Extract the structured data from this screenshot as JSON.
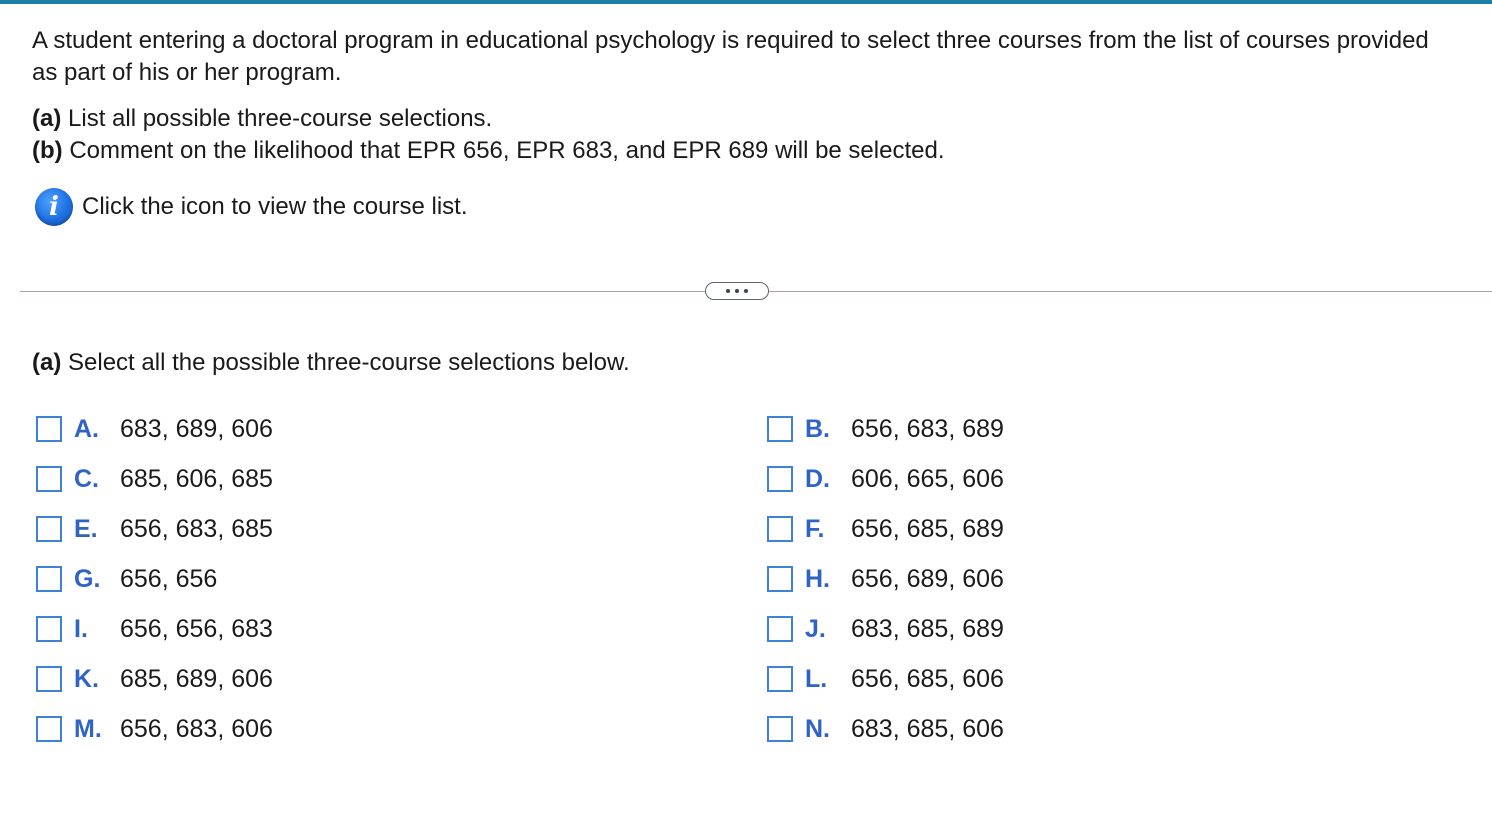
{
  "question": {
    "text": "A student entering a doctoral program in educational psychology is required to select three courses from the list of courses provided as part of his or her program.",
    "part_a_label": "(a)",
    "part_a_text": " List all possible three-course selections.",
    "part_b_label": "(b)",
    "part_b_text": " Comment on the likelihood that EPR 656, EPR 683, and EPR 689 will be selected.",
    "info_text": "Click the icon to view the course list."
  },
  "answer": {
    "part_label": "(a)",
    "prompt": " Select all the possible three-course selections below.",
    "options": [
      {
        "letter": "A.",
        "value": "683, 689, 606"
      },
      {
        "letter": "B.",
        "value": "656, 683, 689"
      },
      {
        "letter": "C.",
        "value": "685, 606, 685"
      },
      {
        "letter": "D.",
        "value": "606, 665, 606"
      },
      {
        "letter": "E.",
        "value": "656, 683, 685"
      },
      {
        "letter": "F.",
        "value": "656, 685, 689"
      },
      {
        "letter": "G.",
        "value": "656, 656"
      },
      {
        "letter": "H.",
        "value": "656, 689, 606"
      },
      {
        "letter": "I.",
        "value": "656, 656, 683"
      },
      {
        "letter": "J.",
        "value": "683, 685, 689"
      },
      {
        "letter": "K.",
        "value": "685, 689, 606"
      },
      {
        "letter": "L.",
        "value": "656, 685, 606"
      },
      {
        "letter": "M.",
        "value": "656, 683, 606"
      },
      {
        "letter": "N.",
        "value": "683, 685, 606"
      }
    ]
  },
  "colors": {
    "accent_bar": "#1b7fa6",
    "option_letter": "#2f63c4",
    "checkbox_border": "#3d82d6",
    "info_icon": "#1e6fe0"
  },
  "icons": {
    "info": "info-icon",
    "more": "ellipsis-icon"
  }
}
